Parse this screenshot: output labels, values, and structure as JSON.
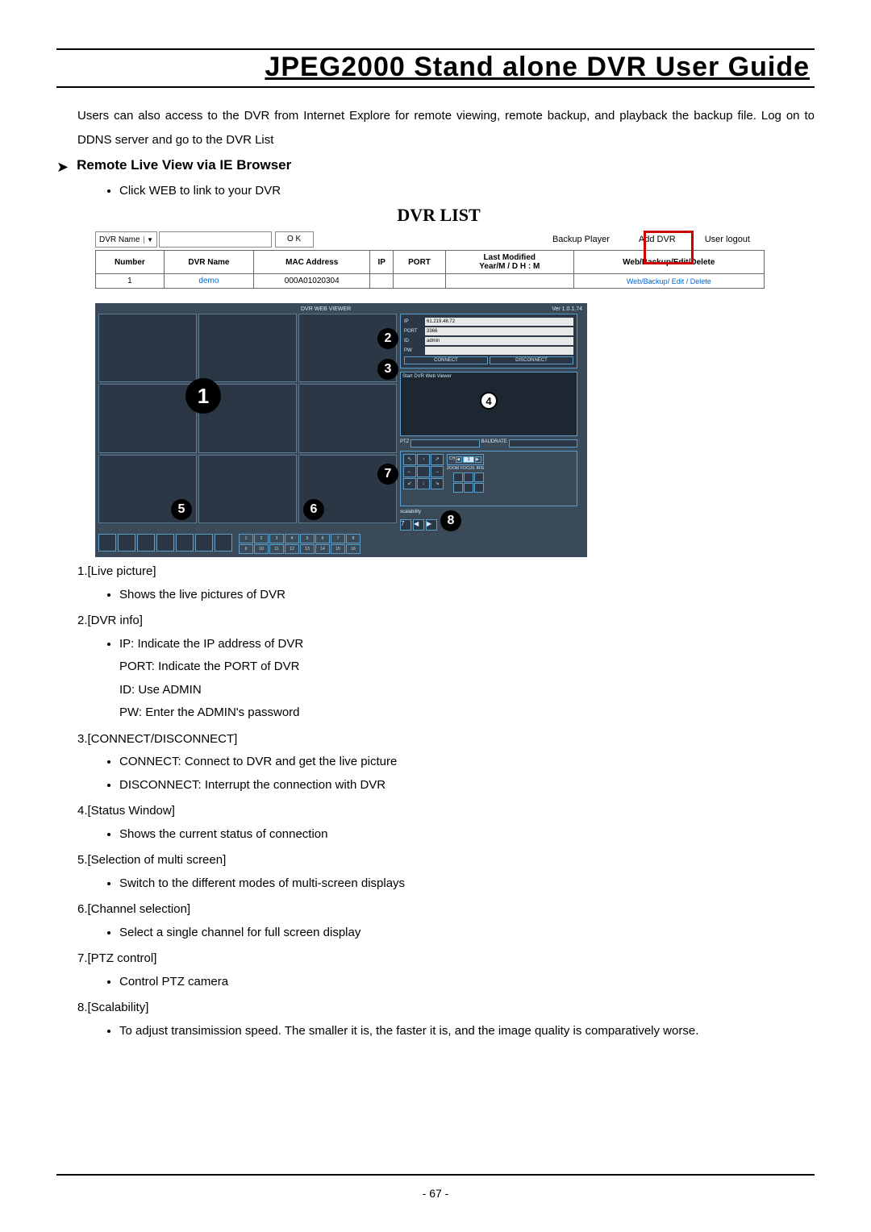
{
  "doc_title": "JPEG2000  Stand  alone  DVR  User  Guide",
  "intro": "Users can also access to the DVR from Internet Explore for remote viewing, remote backup, and playback the backup file. Log on to DDNS server and go to the DVR List",
  "section_heading": "Remote Live View via IE Browser",
  "bullet_click_web": "Click WEB to link to your DVR",
  "fig_title": "DVR LIST",
  "top": {
    "dvr_name_label": "DVR Name",
    "ok_btn": "O K",
    "backup_player": "Backup Player",
    "add_dvr": "Add DVR",
    "user_logout": "User logout"
  },
  "table": {
    "headers": [
      "Number",
      "DVR Name",
      "MAC Address",
      "IP",
      "PORT",
      "Last Modified\nYear/M / D  H : M",
      "Web/Backup/Edit/Delete"
    ],
    "row": {
      "num": "1",
      "name": "demo",
      "mac": "000A01020304",
      "ip": "",
      "port": "",
      "mod": "",
      "act": "Web/Backup/ Edit / Delete"
    }
  },
  "viewer": {
    "top_left": "DVR WEB VIEWER",
    "top_right": "Ver 1.0.1.74",
    "ip_label": "IP",
    "ip_val": "61.219.48.72",
    "port_label": "PORT",
    "port_val": "3366",
    "id_label": "ID",
    "id_val": "admin",
    "pw_label": "PW",
    "pw_val": "",
    "connect": "CONNECT",
    "disconnect": "DISCONNECT",
    "status_text": "Start DVR Web Viewer",
    "ptz": "PTZ",
    "baud": "BAUDRATE",
    "ch_head": "CH",
    "zoom": "ZOOM",
    "focus": "FOCUS",
    "iris": "IRIS",
    "scal": "scalability"
  },
  "items": [
    {
      "h": "1.[Live picture]",
      "b": [
        "Shows the live pictures of DVR"
      ]
    },
    {
      "h": "2.[DVR info]",
      "b": [
        "IP: Indicate the IP address of DVR"
      ],
      "sub": [
        "PORT: Indicate the PORT of DVR",
        "ID: Use ADMIN",
        "PW: Enter the ADMIN's password"
      ]
    },
    {
      "h": "3.[CONNECT/DISCONNECT]",
      "b": [
        "CONNECT: Connect to DVR and get the live picture",
        "DISCONNECT: Interrupt the connection with DVR"
      ]
    },
    {
      "h": "4.[Status Window]",
      "b": [
        "Shows the current status of connection"
      ]
    },
    {
      "h": "5.[Selection of multi screen]",
      "b": [
        "Switch to the different modes of multi-screen displays"
      ]
    },
    {
      "h": "6.[Channel selection]",
      "b": [
        "Select a single channel for full screen display"
      ]
    },
    {
      "h": "7.[PTZ control]",
      "b": [
        "Control PTZ camera"
      ]
    },
    {
      "h": "8.[Scalability]",
      "b": [
        "To adjust transimission speed. The smaller it is, the faster it is, and the image quality is comparatively worse."
      ]
    }
  ],
  "page_num": "- 67 -"
}
